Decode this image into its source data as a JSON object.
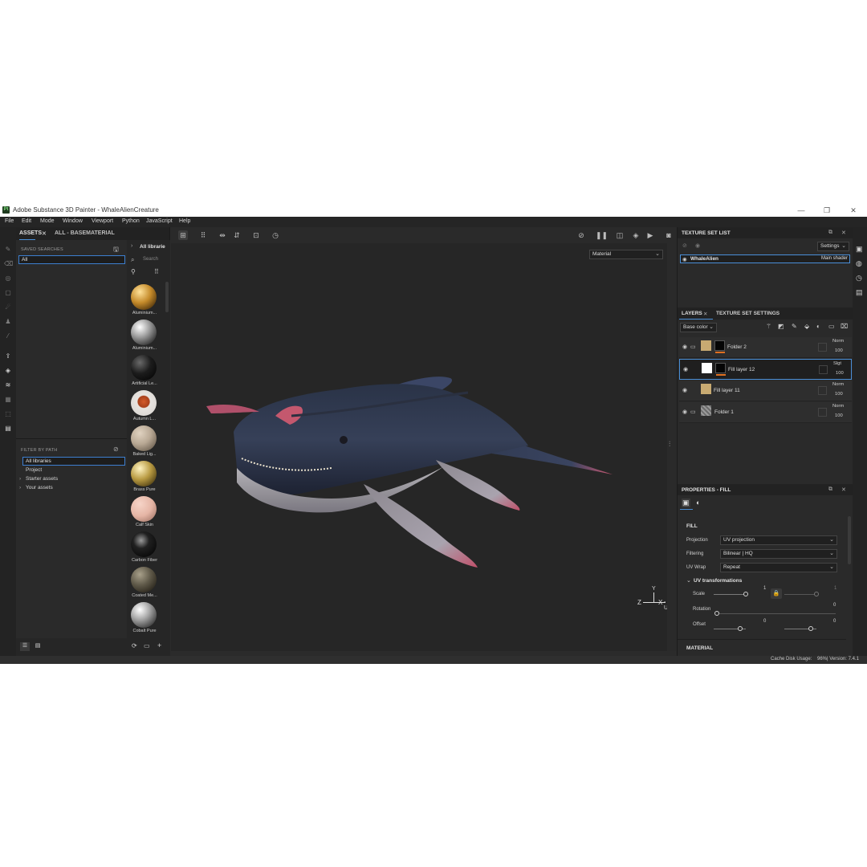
{
  "window": {
    "app_icon": "Pt",
    "title": "Adobe Substance 3D Painter - WhaleAlienCreature",
    "minimize": "—",
    "maximize": "❐",
    "close": "✕"
  },
  "menu": [
    "File",
    "Edit",
    "Mode",
    "Window",
    "Viewport",
    "Python",
    "JavaScript",
    "Help"
  ],
  "assets": {
    "tab_assets": "ASSETS",
    "tab_close": "✕",
    "tab_filter": "ALL - BASEMATERIAL",
    "saved_searches_label": "SAVED SEARCHES",
    "saved_search_value": "All",
    "filter_by_path_label": "FILTER BY PATH",
    "paths": [
      "All libraries",
      "Project",
      "Starter assets",
      "Your assets"
    ],
    "library_title": "All librarie",
    "search_placeholder": "Search",
    "materials": [
      {
        "name": "Aluminium...",
        "color": "#c48a2a"
      },
      {
        "name": "Aluminium...",
        "color": "#9e9e9e"
      },
      {
        "name": "Artificial Le...",
        "color": "#1c1c1c"
      },
      {
        "name": "Autumn L...",
        "color": "#d45a2a"
      },
      {
        "name": "Baked Lig...",
        "color": "#b8a894"
      },
      {
        "name": "Brass Pure",
        "color": "#b89a42"
      },
      {
        "name": "Calf Skin",
        "color": "#e5b5a5"
      },
      {
        "name": "Carbon Fiber",
        "color": "#202020"
      },
      {
        "name": "Coated Me...",
        "color": "#5e5848"
      },
      {
        "name": "Cobalt Pure",
        "color": "#a6a6a6"
      }
    ]
  },
  "viewport": {
    "mode_dropdown": "Material",
    "axis_labels": {
      "z": "Z",
      "x": "X",
      "y": "Y",
      "u": "-U"
    }
  },
  "texture_set_list": {
    "title": "TEXTURE SET LIST",
    "settings_btn": "Settings",
    "items": [
      {
        "name": "WhaleAlien",
        "shader": "Main shader"
      }
    ]
  },
  "layers": {
    "tab_layers": "LAYERS",
    "tab_close": "✕",
    "tab_settings": "TEXTURE SET SETTINGS",
    "channel_dropdown": "Base color",
    "rows": [
      {
        "name": "Folder 2",
        "blend": "Norm",
        "opacity": "100",
        "thumb_color": "#c8aa72"
      },
      {
        "name": "Fill layer 12",
        "blend": "Slgt",
        "opacity": "100",
        "thumb_color": "#ffffff"
      },
      {
        "name": "Fill layer 11",
        "blend": "Norm",
        "opacity": "100",
        "thumb_color": "#c8aa72"
      },
      {
        "name": "Folder 1",
        "blend": "Norm",
        "opacity": "100",
        "thumb_color": "#7c7c7c"
      }
    ]
  },
  "properties": {
    "title": "PROPERTIES - FILL",
    "section_fill": "FILL",
    "projection_label": "Projection",
    "projection_value": "UV projection",
    "filtering_label": "Filtering",
    "filtering_value": "Bilinear | HQ",
    "uvwrap_label": "UV Wrap",
    "uvwrap_value": "Repeat",
    "uv_transformations": "UV transformations",
    "scale_label": "Scale",
    "scale_value": "1",
    "scale_value2": "1",
    "rotation_label": "Rotation",
    "rotation_value": "0",
    "offset_label": "Offset",
    "offset_value_1": "0",
    "offset_value_2": "0",
    "section_material": "MATERIAL"
  },
  "status": {
    "cache": "Cache Disk Usage:",
    "cache_value": "96%",
    "version": "| Version: 7.4.1"
  }
}
